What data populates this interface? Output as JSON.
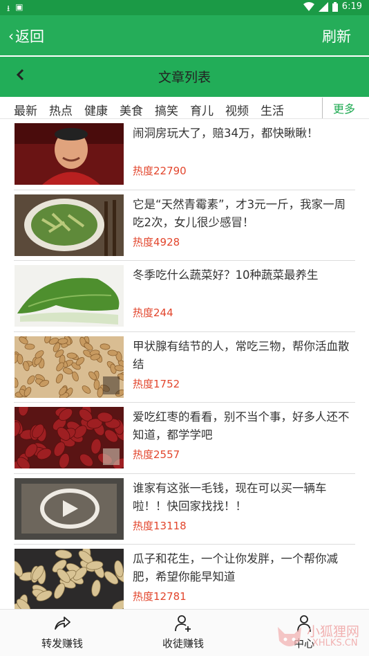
{
  "status_bar": {
    "time": "6:19"
  },
  "app_bar": {
    "back_label": "返回",
    "refresh_label": "刷新"
  },
  "title_bar": {
    "title": "文章列表"
  },
  "categories": {
    "items": [
      "最新",
      "热点",
      "健康",
      "美食",
      "搞笑",
      "育儿",
      "视频",
      "生活"
    ],
    "more_label": "更多"
  },
  "articles": [
    {
      "title": "闹洞房玩大了，赔34万，都快瞅瞅！",
      "heat": "热度22790",
      "thumb": "comedian-photo"
    },
    {
      "title": "它是“天然青霉素”，才3元一斤，我家一周吃2次，女儿很少感冒！",
      "heat": "热度4928",
      "thumb": "vegetable-dish-photo"
    },
    {
      "title": "冬季吃什么蔬菜好？10种蔬菜最养生",
      "heat": "热度244",
      "thumb": "bok-choy-photo"
    },
    {
      "title": "甲状腺有结节的人，常吃三物，帮你活血散结",
      "heat": "热度1752",
      "thumb": "pine-nuts-photo"
    },
    {
      "title": "爱吃红枣的看看，别不当个事，好多人还不知道，都学学吧",
      "heat": "热度2557",
      "thumb": "red-dates-photo"
    },
    {
      "title": "谁家有这张一毛钱，现在可以买一辆车啦！！快回家找找！！",
      "heat": "热度13118",
      "thumb": "video-banknote-photo"
    },
    {
      "title": "瓜子和花生，一个让你发胖，一个帮你减肥，希望你能早知道",
      "heat": "热度12781",
      "thumb": "peanuts-seeds-photo"
    }
  ],
  "bottom_nav": {
    "items": [
      {
        "label": "转发赚钱",
        "icon": "share-icon"
      },
      {
        "label": "收徒赚钱",
        "icon": "add-user-icon"
      },
      {
        "label": "中心",
        "icon": "user-icon"
      }
    ]
  },
  "watermark": {
    "text": "小狐狸网",
    "url": "XHLKS.CN"
  },
  "colors": {
    "primary": "#25ad59",
    "status": "#1b9a46",
    "heat": "#e2452c",
    "more": "#1faa52"
  }
}
